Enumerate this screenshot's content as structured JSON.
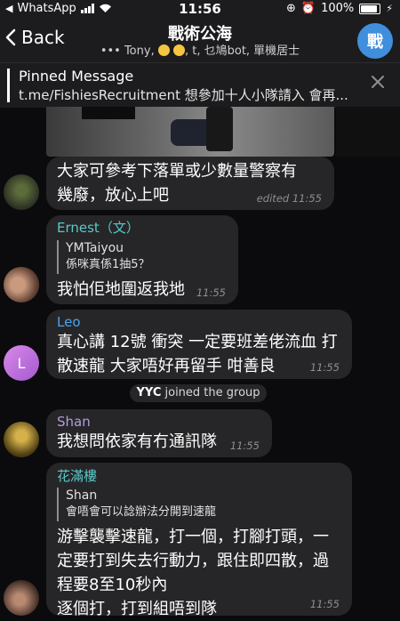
{
  "status": {
    "carrier": "WhatsApp",
    "time": "11:56",
    "battery": "100%"
  },
  "header": {
    "back_label": "Back",
    "title": "戰術公海",
    "members_a": "••• Tony,",
    "members_b": ", t, 乜鳩bot, 單機居士",
    "avatar_letter": "戰"
  },
  "pinned": {
    "heading": "Pinned Message",
    "text": "t.me/FishiesRecruitment 想參加十人小隊請入 會再..."
  },
  "messages": [
    {
      "lines": [
        "大家可參考下落單或少數量警察有",
        "幾廢，放心上吧"
      ],
      "time": "edited 11:55"
    },
    {
      "name": "Ernest（文）",
      "name_color": "#5ac8c8",
      "reply_name": "YMTaiyou",
      "reply_text": "係咪真係1抽5？",
      "lines": [
        "我怕佢地圍返我地"
      ],
      "time": "11:55"
    },
    {
      "name": "Leo",
      "name_color": "#4aa3f0",
      "avatar_letter": "L",
      "lines": [
        "真心講 12號 衝突 一定要班差佬流血 打",
        "散速龍 大家唔好再留手 咁善良"
      ],
      "time": "11:55"
    },
    {
      "name": "Shan",
      "name_color": "#b39ddb",
      "lines": [
        "我想問依家有冇通訊隊"
      ],
      "time": "11:55"
    },
    {
      "name": "花滿樓",
      "name_color": "#5ac8c8",
      "reply_name": "Shan",
      "reply_text": "會唔會可以諗辦法分開到速龍",
      "lines": [
        "游擊襲擊速龍，打一個，打腳打頭，一",
        "定要打到失去行動力，跟住即四散，過",
        "程要8至10秒內",
        "逐個打，打到組唔到隊"
      ],
      "time": "11:55"
    }
  ],
  "system": {
    "user": "YYC",
    "action": "joined the group"
  },
  "colors": {
    "background": "#0b0b0d",
    "bubble": "#262628",
    "accent": "#3f8fdc"
  }
}
